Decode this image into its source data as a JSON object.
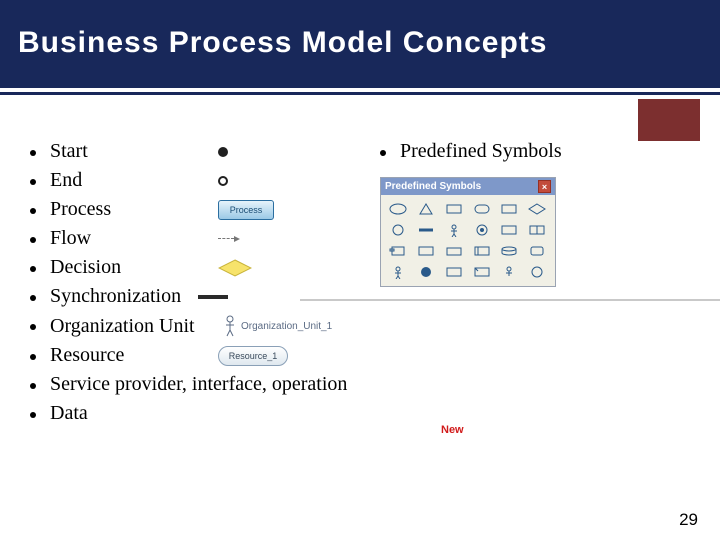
{
  "slide": {
    "title": "Business Process Model Concepts",
    "page_number": "29"
  },
  "concepts": [
    {
      "label": "Start"
    },
    {
      "label": "End"
    },
    {
      "label": "Process",
      "icon_text": "Process"
    },
    {
      "label": "Flow"
    },
    {
      "label": "Decision"
    },
    {
      "label": "Synchronization"
    },
    {
      "label": "Organization Unit",
      "icon_text": "Organization_Unit_1"
    },
    {
      "label": "Resource",
      "icon_text": "Resource_1"
    },
    {
      "label": "Service provider, interface, operation"
    },
    {
      "label": "Data"
    }
  ],
  "right": {
    "heading": "Predefined Symbols",
    "palette_title": "Predefined Symbols",
    "new_label": "New"
  }
}
